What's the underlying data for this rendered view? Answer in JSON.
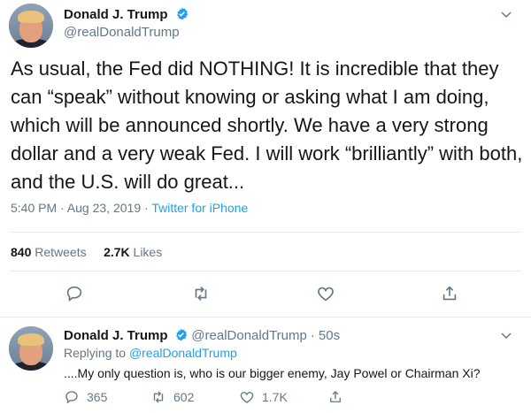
{
  "tweet": {
    "author_name": "Donald J. Trump",
    "author_handle": "@realDonaldTrump",
    "text": "As usual, the Fed did NOTHING! It is incredible that they can “speak” without knowing or asking what I am doing, which will be announced shortly. We have a very strong dollar and a very weak Fed. I will work “brilliantly” with both, and the U.S. will do great...",
    "timestamp": "5:40 PM · Aug 23, 2019",
    "separator": "·",
    "source": "Twitter for iPhone",
    "retweets_count": "840",
    "retweets_label": "Retweets",
    "likes_count": "2.7K",
    "likes_label": "Likes",
    "icons": [
      "reply-icon",
      "retweet-icon",
      "like-icon",
      "share-icon",
      "verified-badge-icon",
      "chevron-down-icon"
    ]
  },
  "reply": {
    "author_name": "Donald J. Trump",
    "author_handle": "@realDonaldTrump",
    "age": "· 50s",
    "replying_label": "Replying to",
    "replying_to": "@realDonaldTrump",
    "text": "....My only question is, who is our bigger enemy, Jay Powel or Chairman Xi?",
    "reply_count": "365",
    "retweet_count": "602",
    "like_count": "1.7K"
  },
  "colors": {
    "accent": "#1da1f2",
    "muted": "#657786",
    "text": "#14171a",
    "divider": "#e6ecf0"
  }
}
